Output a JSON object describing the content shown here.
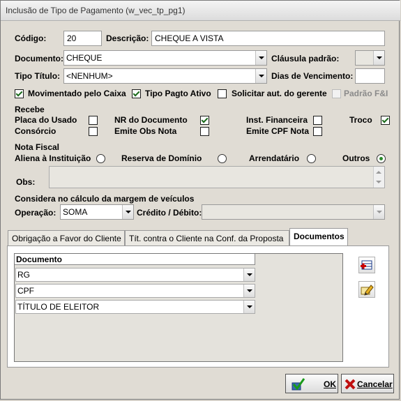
{
  "window": {
    "title": "Inclusão de Tipo de Pagamento (w_vec_tp_pg1)"
  },
  "fields": {
    "codigo_label": "Código:",
    "codigo_value": "20",
    "descricao_label": "Descrição:",
    "descricao_value": "CHEQUE A VISTA",
    "documento_label": "Documento:",
    "documento_value": "CHEQUE",
    "clausula_label": "Cláusula padrão:",
    "clausula_value": "",
    "tipo_titulo_label": "Tipo Título:",
    "tipo_titulo_value": "<NENHUM>",
    "dias_venc_label": "Dias de Vencimento:",
    "dias_venc_value": ""
  },
  "checks_top": {
    "movimentado": {
      "label": "Movimentado pelo Caixa",
      "checked": true
    },
    "tipo_pagto": {
      "label": "Tipo Pagto Ativo",
      "checked": true
    },
    "solicitar": {
      "label": "Solicitar aut. do gerente",
      "checked": false
    },
    "padrao_fi": {
      "label": "Padrão F&I",
      "checked": false
    }
  },
  "recebe": {
    "title": "Recebe",
    "placa": {
      "label": "Placa do Usado",
      "checked": false
    },
    "consorcio": {
      "label": "Consórcio",
      "checked": false
    },
    "nr_doc": {
      "label": "NR do Documento",
      "checked": true
    },
    "emite_obs": {
      "label": "Emite Obs Nota",
      "checked": false
    },
    "inst_fin": {
      "label": "Inst. Financeira",
      "checked": false
    },
    "emite_cpf": {
      "label": "Emite CPF Nota",
      "checked": false
    },
    "troco": {
      "label": "Troco",
      "checked": true
    }
  },
  "nota_fiscal": {
    "title": "Nota Fiscal",
    "aliena": {
      "label": "Aliena à Instituição",
      "selected": false
    },
    "reserva": {
      "label": "Reserva de Domínio",
      "selected": false
    },
    "arrendatario": {
      "label": "Arrendatário",
      "selected": false
    },
    "outros": {
      "label": "Outros",
      "selected": true
    },
    "obs_label": "Obs:",
    "obs_value": ""
  },
  "margem": {
    "title": "Considera no cálculo da margem de veículos",
    "operacao_label": "Operação:",
    "operacao_value": "SOMA",
    "credito_label": "Crédito / Débito:",
    "credito_value": ""
  },
  "tabs": [
    {
      "label": "Obrigação a Favor do Cliente",
      "active": false
    },
    {
      "label": "Tít. contra o Cliente na Conf. da Proposta",
      "active": false
    },
    {
      "label": "Documentos",
      "active": true
    }
  ],
  "documentos": {
    "header": "Documento",
    "rows": [
      "RG",
      "CPF",
      "TÍTULO DE ELEITOR"
    ]
  },
  "buttons": {
    "ok": "OK",
    "cancelar": "Cancelar"
  },
  "icons": {
    "add_row": "add-row-icon",
    "edit": "edit-icon",
    "ok": "ok-check-icon",
    "cancel": "cancel-x-icon"
  }
}
